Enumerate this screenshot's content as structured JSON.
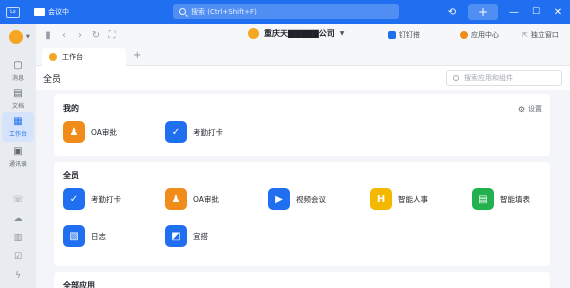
{
  "titlebar": {
    "app_badge": "Lx",
    "meeting_label": "会议中",
    "search_placeholder": "搜索 (Ctrl+Shift+F)",
    "icons": [
      "history-icon",
      "plus-icon",
      "minimize-icon",
      "maximize-icon",
      "close-icon"
    ]
  },
  "sidebar": {
    "items": [
      {
        "label": "消息",
        "icon": "message-icon"
      },
      {
        "label": "文档",
        "icon": "document-icon"
      },
      {
        "label": "工作台",
        "icon": "workbench-icon",
        "active": true
      },
      {
        "label": "通讯录",
        "icon": "contacts-icon"
      }
    ],
    "small_icons": [
      "phone-icon",
      "cloud-icon",
      "calendar-icon",
      "todo-icon",
      "lightning-icon"
    ]
  },
  "toolbar": {
    "company_name": "重庆天▇▇▇▇▇公司",
    "dingding_label": "钉钉搭",
    "app_center_label": "应用中心",
    "standalone_window_label": "独立窗口"
  },
  "tab": {
    "label": "工作台"
  },
  "content": {
    "staff_title": "全员",
    "app_search_placeholder": "搜索应用和组件",
    "mine": {
      "title": "我的",
      "settings_label": "设置",
      "apps": [
        {
          "label": "OA审批",
          "color": "#f08c1a",
          "icon": "person-icon"
        },
        {
          "label": "考勤打卡",
          "color": "#1f6ff0",
          "icon": "shield-check-icon"
        }
      ]
    },
    "all": {
      "title": "全员",
      "apps": [
        {
          "label": "考勤打卡",
          "color": "#1f6ff0",
          "icon": "shield-check-icon"
        },
        {
          "label": "OA审批",
          "color": "#f08c1a",
          "icon": "person-icon"
        },
        {
          "label": "视频会议",
          "color": "#1f6ff0",
          "icon": "video-icon"
        },
        {
          "label": "智能人事",
          "color": "#f5b800",
          "icon": "hr-icon"
        },
        {
          "label": "智能填表",
          "color": "#23b14d",
          "icon": "form-icon"
        },
        {
          "label": "日志",
          "color": "#1f6ff0",
          "icon": "log-icon"
        },
        {
          "label": "宜搭",
          "color": "#1f6ff0",
          "icon": "yida-icon"
        }
      ]
    },
    "all_apps_title": "全部应用"
  }
}
